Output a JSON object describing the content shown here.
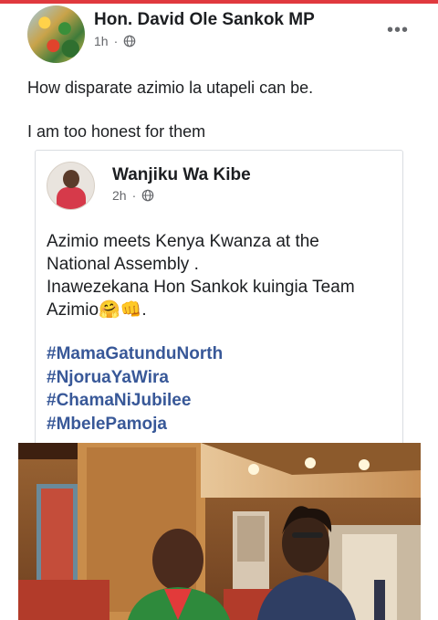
{
  "post": {
    "author": "Hon. David Ole Sankok MP",
    "time": "1h",
    "separator": "·",
    "more": "•••",
    "text_line1": "How disparate azimio la utapeli can be.",
    "text_line2": "I am too honest for them"
  },
  "shared_post": {
    "author": "Wanjiku Wa Kibe",
    "time": "2h",
    "separator": "·",
    "body_line1": "Azimio meets Kenya Kwanza at the",
    "body_line2": "National Assembly .",
    "body_line3": "Inawezekana Hon Sankok kuingia Team",
    "body_line4_text": "Azimio",
    "body_line4_emoji": "🤗👊",
    "body_line4_end": ".",
    "hashtags": [
      "#MamaGatunduNorth",
      "#NjoruaYaWira",
      "#ChamaNiJubilee",
      "#MbelePamoja"
    ]
  },
  "colors": {
    "accent_bar": "#e0393e",
    "hashtag": "#385898",
    "meta_text": "#65676b"
  },
  "icons": {
    "privacy": "globe-icon",
    "menu": "more-options-icon"
  }
}
